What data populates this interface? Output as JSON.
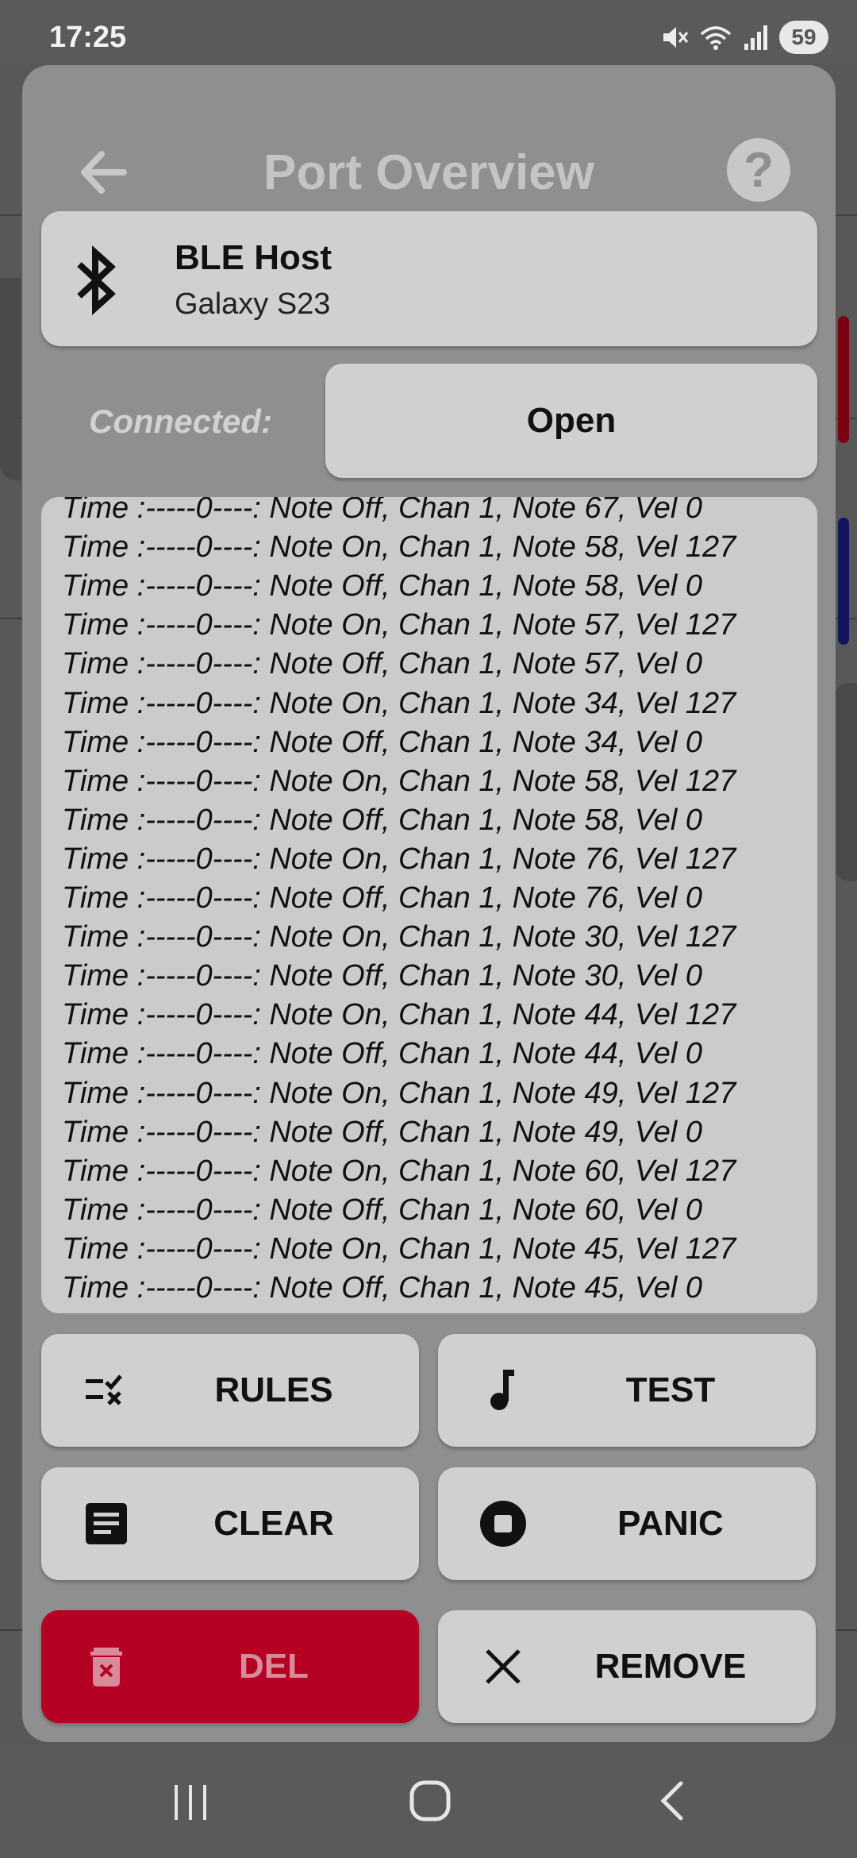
{
  "status_bar": {
    "time": "17:25",
    "battery": "59"
  },
  "dialog": {
    "title": "Port Overview",
    "help_symbol": "?",
    "host": {
      "name": "BLE Host",
      "device": "Galaxy S23"
    },
    "connected_label": "Connected:",
    "open_button": "Open",
    "log_lines": [
      "Time :-----0----: Note Off, Chan 1, Note 67, Vel 0",
      "Time :-----0----: Note On, Chan 1, Note 58, Vel 127",
      "Time :-----0----: Note Off, Chan 1, Note 58, Vel 0",
      "Time :-----0----: Note On, Chan 1, Note 57, Vel 127",
      "Time :-----0----: Note Off, Chan 1, Note 57, Vel 0",
      "Time :-----0----: Note On, Chan 1, Note 34, Vel 127",
      "Time :-----0----: Note Off, Chan 1, Note 34, Vel 0",
      "Time :-----0----: Note On, Chan 1, Note 58, Vel 127",
      "Time :-----0----: Note Off, Chan 1, Note 58, Vel 0",
      "Time :-----0----: Note On, Chan 1, Note 76, Vel 127",
      "Time :-----0----: Note Off, Chan 1, Note 76, Vel 0",
      "Time :-----0----: Note On, Chan 1, Note 30, Vel 127",
      "Time :-----0----: Note Off, Chan 1, Note 30, Vel 0",
      "Time :-----0----: Note On, Chan 1, Note 44, Vel 127",
      "Time :-----0----: Note Off, Chan 1, Note 44, Vel 0",
      "Time :-----0----: Note On, Chan 1, Note 49, Vel 127",
      "Time :-----0----: Note Off, Chan 1, Note 49, Vel 0",
      "Time :-----0----: Note On, Chan 1, Note 60, Vel 127",
      "Time :-----0----: Note Off, Chan 1, Note 60, Vel 0",
      "Time :-----0----: Note On, Chan 1, Note 45, Vel 127",
      "Time :-----0----: Note Off, Chan 1, Note 45, Vel 0"
    ],
    "buttons": {
      "rules": "RULES",
      "test": "TEST",
      "clear": "CLEAR",
      "panic": "PANIC",
      "del": "DEL",
      "remove": "REMOVE"
    }
  },
  "colors": {
    "dialog_bg": "#8f8f8f",
    "card_bg": "#d0d0d0",
    "danger": "#b30023"
  },
  "icons": [
    "back-arrow-icon",
    "help-icon",
    "bluetooth-icon",
    "rules-icon",
    "music-note-icon",
    "document-icon",
    "stop-icon",
    "trash-icon",
    "close-icon",
    "recents-icon",
    "home-icon",
    "nav-back-icon"
  ]
}
